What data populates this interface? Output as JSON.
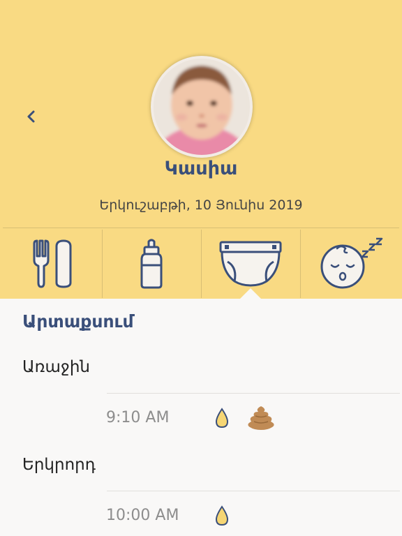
{
  "profile": {
    "name": "Կասիա",
    "date": "Երկուշաբթի, 10 Յունիս 2019"
  },
  "nav": {
    "back_icon": "chevron-left-icon"
  },
  "tabs": [
    {
      "icon": "cutlery-icon",
      "active": false
    },
    {
      "icon": "bottle-icon",
      "active": false
    },
    {
      "icon": "diaper-icon",
      "active": true
    },
    {
      "icon": "sleep-icon",
      "active": false
    }
  ],
  "section": {
    "title": "Արտաքսում"
  },
  "entries": [
    {
      "label": "Առաջին",
      "time": "9:10 AM",
      "icons": [
        "pee-icon",
        "poo-icon"
      ]
    },
    {
      "label": "Երկրորդ",
      "time": "10:00 AM",
      "icons": [
        "pee-icon"
      ]
    }
  ],
  "colors": {
    "header_bg": "#f9da83",
    "accent": "#3a4f7a",
    "body_bg": "#f9f8f7",
    "pee": "#f6d674",
    "poo": "#c08b55"
  }
}
